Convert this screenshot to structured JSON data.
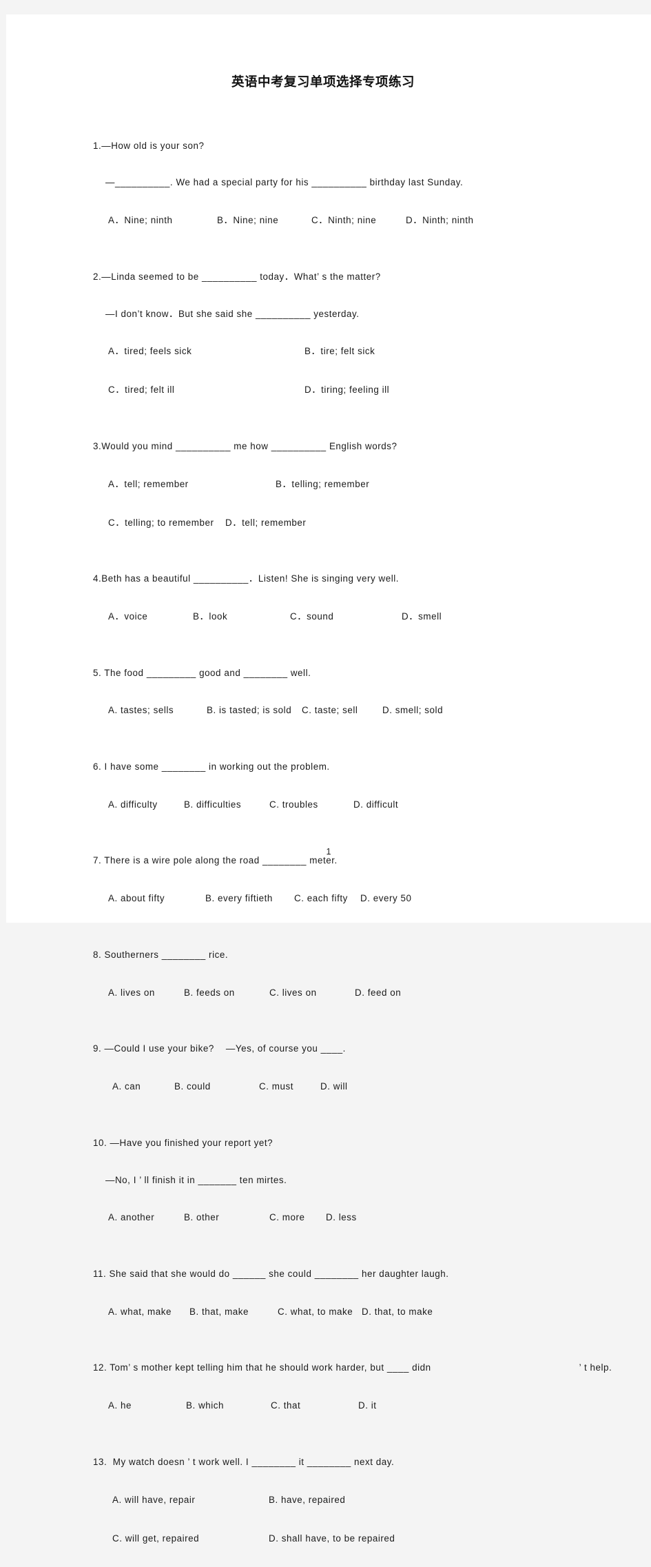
{
  "document": {
    "title": "英语中考复习单项选择专项练习",
    "page_number": "1"
  },
  "questions": [
    {
      "number": "1",
      "stem_lines": [
        "1.—How old is your son?",
        "—__________. We had a special party for his __________ birthday last Sunday."
      ],
      "options_rows": [
        [
          "A．Nine; ninth",
          "B．Nine; nine",
          "C．Ninth; nine",
          "D．Ninth; ninth"
        ]
      ]
    },
    {
      "number": "2",
      "stem_lines": [
        "2.—Linda seemed to be __________ today．What’ s the matter?",
        "—I don’t know．But she said she __________ yesterday."
      ],
      "options_rows": [
        [
          "A．tired; feels sick",
          "B．tire; felt sick"
        ],
        [
          "C．tired; felt ill",
          "D．tiring; feeling ill"
        ]
      ]
    },
    {
      "number": "3",
      "stem_lines": [
        "3.Would you mind __________ me how __________ English words?"
      ],
      "options_rows": [
        [
          "A．tell; remember",
          "B．telling; remember"
        ],
        [
          "C．telling; to remember",
          "D．tell; remember"
        ]
      ]
    },
    {
      "number": "4",
      "stem_lines": [
        "4.Beth has a beautiful __________．Listen! She is singing very well."
      ],
      "options_rows": [
        [
          "A．voice",
          "B．look",
          "C．sound",
          "D．smell"
        ]
      ]
    },
    {
      "number": "5",
      "stem_lines": [
        "5. The food _________ good and ________ well."
      ],
      "options_rows": [
        [
          "A. tastes; sells",
          "B. is tasted; is sold",
          "C. taste; sell",
          "D. smell; sold"
        ]
      ]
    },
    {
      "number": "6",
      "stem_lines": [
        "6. I have some ________ in working out the problem."
      ],
      "options_rows": [
        [
          "A. difficulty",
          "B. difficulties",
          "C. troubles",
          "D. difficult"
        ]
      ]
    },
    {
      "number": "7",
      "stem_lines": [
        "7. There is a wire pole along the road ________ meter."
      ],
      "options_rows": [
        [
          "A. about fifty",
          "B. every fiftieth",
          "C. each fifty",
          "D. every 50"
        ]
      ]
    },
    {
      "number": "8",
      "stem_lines": [
        "8. Southerners ________ rice."
      ],
      "options_rows": [
        [
          "A. lives on",
          "B. feeds on",
          "C. lives on",
          "D. feed on"
        ]
      ]
    },
    {
      "number": "9",
      "stem_lines": [
        "9. —Could I use your bike?    —Yes, of course you ____."
      ],
      "options_rows": [
        [
          "A. can",
          "B. could",
          "C. must",
          "D. will"
        ]
      ]
    },
    {
      "number": "10",
      "stem_lines": [
        "10. —Have you finished your report yet?",
        "—No, I ’ ll finish it in _______ ten mirtes."
      ],
      "options_rows": [
        [
          "A. another",
          "B. other",
          "C. more",
          "D. less"
        ]
      ]
    },
    {
      "number": "11",
      "stem_lines": [
        "11. She said that she would do ______ she could ________ her daughter laugh."
      ],
      "options_rows": [
        [
          "A. what, make",
          "B. that, make",
          "C. what, to make",
          "D. that, to make"
        ]
      ]
    },
    {
      "number": "12",
      "stem_lines": [
        "12. Tom’ s mother kept telling him that he should work harder, but ____ didn",
        "’ t help."
      ],
      "options_rows": [
        [
          "A. he",
          "B. which",
          "C. that",
          "D. it"
        ]
      ]
    },
    {
      "number": "13",
      "stem_lines": [
        "13.  My watch doesn ’ t work well. I ________ it ________ next day."
      ],
      "options_rows": [
        [
          "A. will have, repair",
          "B. have, repaired"
        ],
        [
          "C. will get, repaired",
          "D. shall have, to be repaired"
        ]
      ]
    }
  ]
}
